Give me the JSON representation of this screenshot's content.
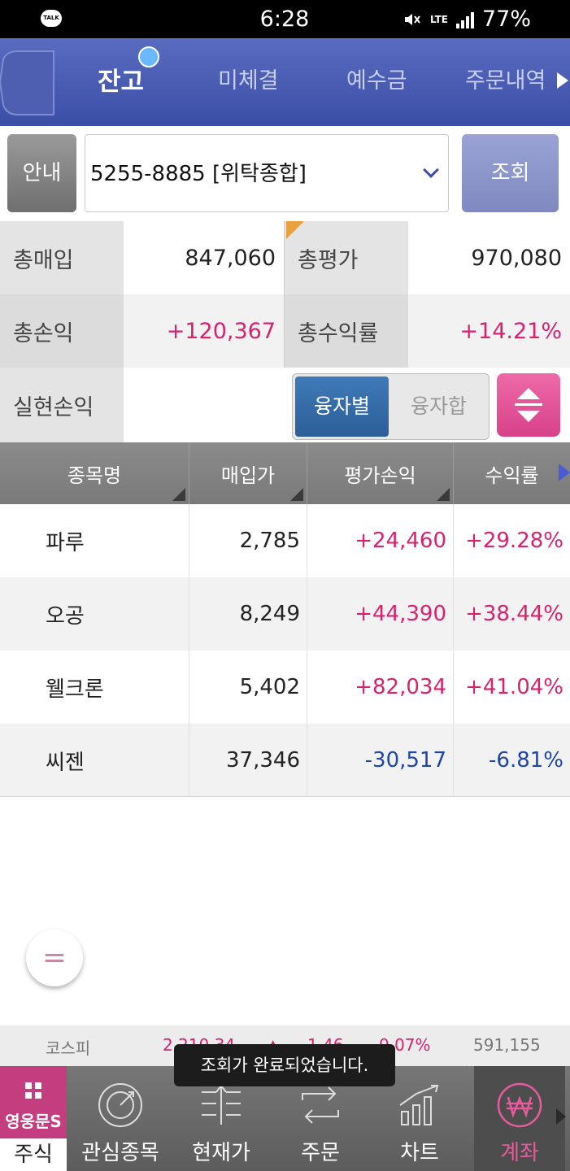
{
  "status_bar": {
    "talk": "TALK",
    "time": "6:28",
    "network": "LTE",
    "battery": "77%"
  },
  "tabs": [
    {
      "label": "잔고",
      "active": true
    },
    {
      "label": "미체결",
      "active": false
    },
    {
      "label": "예수금",
      "active": false
    },
    {
      "label": "주문내역",
      "active": false
    }
  ],
  "account": {
    "guide_label": "안내",
    "selected": "5255-8885 [위탁종합]",
    "query_label": "조회"
  },
  "summary": {
    "total_buy_label": "총매입",
    "total_buy": "847,060",
    "total_eval_label": "총평가",
    "total_eval": "970,080",
    "total_pl_label": "총손익",
    "total_pl": "+120,367",
    "total_rate_label": "총수익률",
    "total_rate": "+14.21%",
    "realized_label": "실현손익",
    "realized": "",
    "seg_on": "융자별",
    "seg_off": "융자합"
  },
  "table": {
    "headers": [
      "종목명",
      "매입가",
      "평가손익",
      "수익률"
    ],
    "rows": [
      {
        "name": "파루",
        "price": "2,785",
        "pl": "+24,460",
        "rate": "+29.28%",
        "dir": "pos"
      },
      {
        "name": "오공",
        "price": "8,249",
        "pl": "+44,390",
        "rate": "+38.44%",
        "dir": "pos"
      },
      {
        "name": "웰크론",
        "price": "5,402",
        "pl": "+82,034",
        "rate": "+41.04%",
        "dir": "pos"
      },
      {
        "name": "씨젠",
        "price": "37,346",
        "pl": "-30,517",
        "rate": "-6.81%",
        "dir": "neg"
      }
    ]
  },
  "fab_symbol": "=",
  "ticker": {
    "name": "코스피",
    "value": "2,210.34",
    "arrow": "▲",
    "change": "1.46",
    "rate": "0.07%",
    "volume": "591,155"
  },
  "toast": "조회가 완료되었습니다.",
  "bottom_nav": [
    {
      "label": "주식",
      "logo": "영웅문S"
    },
    {
      "label": "관심종목"
    },
    {
      "label": "현재가"
    },
    {
      "label": "주문"
    },
    {
      "label": "차트"
    },
    {
      "label": "계좌"
    }
  ],
  "colors": {
    "header": "#3b4ea6",
    "positive": "#d6226f",
    "negative": "#1e46a8",
    "accent": "#c43d7e"
  }
}
